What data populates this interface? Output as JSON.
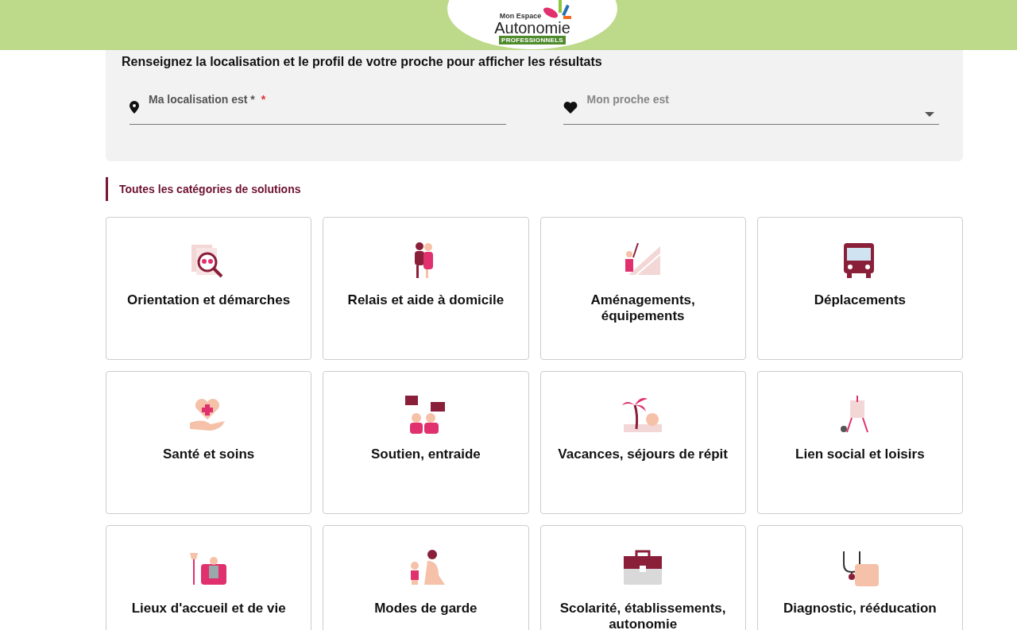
{
  "header": {
    "logo": {
      "top": "Mon Espace",
      "name": "Autonomie",
      "badge": "PROFESSIONNELS"
    }
  },
  "search_panel": {
    "title": "Renseignez la localisation et le profil de votre proche pour afficher les résultats",
    "location_field": {
      "placeholder": "Ma localisation est *",
      "required_mark": "*"
    },
    "relative_field": {
      "placeholder": "Mon proche est"
    }
  },
  "categories": {
    "heading": "Toutes les catégories de solutions",
    "items": [
      {
        "label": "Orientation et démarches"
      },
      {
        "label": "Relais et aide à domicile"
      },
      {
        "label": "Aménagements, équipements"
      },
      {
        "label": "Déplacements"
      },
      {
        "label": "Santé et soins"
      },
      {
        "label": "Soutien, entraide"
      },
      {
        "label": "Vacances, séjours de répit"
      },
      {
        "label": "Lien social et loisirs"
      },
      {
        "label": "Lieux d'accueil et de vie"
      },
      {
        "label": "Modes de garde"
      },
      {
        "label": "Scolarité, établissements, autonomie"
      },
      {
        "label": "Diagnostic, rééducation"
      }
    ]
  }
}
